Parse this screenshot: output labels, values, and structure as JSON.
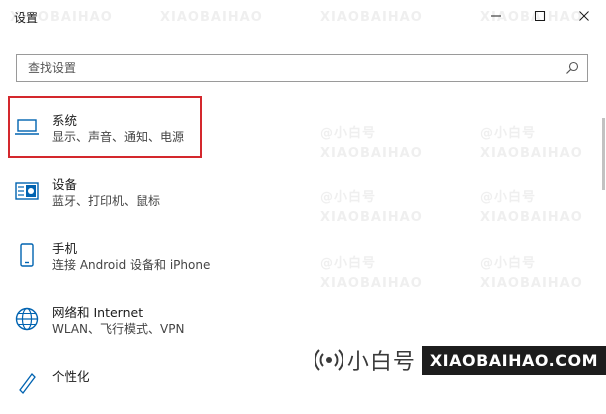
{
  "window": {
    "title": "设置",
    "minimize_icon": "minimize-icon",
    "maximize_icon": "maximize-icon",
    "close_icon": "close-icon"
  },
  "search": {
    "placeholder": "查找设置",
    "icon": "search-icon"
  },
  "categories": [
    {
      "name": "系统",
      "desc": "显示、声音、通知、电源",
      "icon": "laptop-icon",
      "selected": true
    },
    {
      "name": "设备",
      "desc": "蓝牙、打印机、鼠标",
      "icon": "keyboard-icon",
      "selected": false
    },
    {
      "name": "手机",
      "desc": "连接 Android 设备和 iPhone",
      "icon": "phone-icon",
      "selected": false
    },
    {
      "name": "网络和 Internet",
      "desc": "WLAN、飞行模式、VPN",
      "icon": "globe-icon",
      "selected": false
    },
    {
      "name": "个性化",
      "desc": "",
      "icon": "paintbrush-icon",
      "selected": false
    }
  ],
  "watermark": {
    "brand_cn": "小白号",
    "brand_en": "XIAOBAIHAO.COM",
    "icon": "broadcast-icon",
    "tile_cn": "@小白号",
    "tile_en": "XIAOBAIHAO"
  },
  "colors": {
    "accent_selection": "#d4282d",
    "icon_blue": "#0063b1"
  }
}
